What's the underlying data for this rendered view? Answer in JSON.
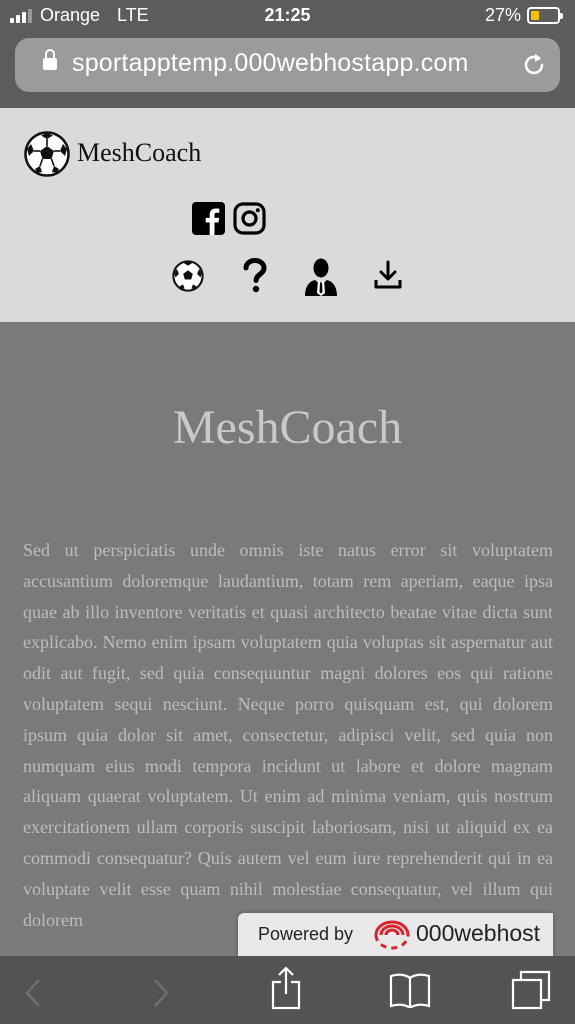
{
  "status": {
    "carrier": "Orange",
    "network": "LTE",
    "time": "21:25",
    "battery_pct": "27%",
    "battery_level": 0.27
  },
  "browser": {
    "url": "sportapptemp.000webhostapp.com"
  },
  "header": {
    "brand": "MeshCoach"
  },
  "main": {
    "title": "MeshCoach",
    "body": "Sed ut perspiciatis unde omnis iste natus error sit voluptatem accusantium doloremque laudantium, totam rem aperiam, eaque ipsa quae ab illo inventore veritatis et quasi architecto beatae vitae dicta sunt explicabo. Nemo enim ipsam voluptatem quia voluptas sit aspernatur aut odit aut fugit, sed quia consequuntur magni dolores eos qui ratione voluptatem sequi nesciunt. Neque porro quisquam est, qui dolorem ipsum quia dolor sit amet, consectetur, adipisci velit, sed quia non numquam eius modi tempora incidunt ut labore et dolore magnam aliquam quaerat voluptatem. Ut enim ad minima veniam, quis nostrum exercitationem ullam corporis suscipit laboriosam, nisi ut aliquid ex ea commodi consequatur? Quis autem vel eum iure reprehenderit qui in ea voluptate velit esse quam nihil molestiae consequatur, vel illum qui dolorem"
  },
  "badge": {
    "powered_by": "Powered by",
    "host": "000webhost"
  },
  "icons": {
    "social": [
      "facebook-icon",
      "instagram-icon"
    ],
    "nav": [
      "soccer-ball-icon",
      "question-icon",
      "user-icon",
      "download-icon"
    ],
    "toolbar": [
      "back-icon",
      "forward-icon",
      "share-icon",
      "bookmarks-icon",
      "tabs-icon"
    ]
  },
  "colors": {
    "battery": "#f2c200",
    "swirl": "#d9232d"
  }
}
